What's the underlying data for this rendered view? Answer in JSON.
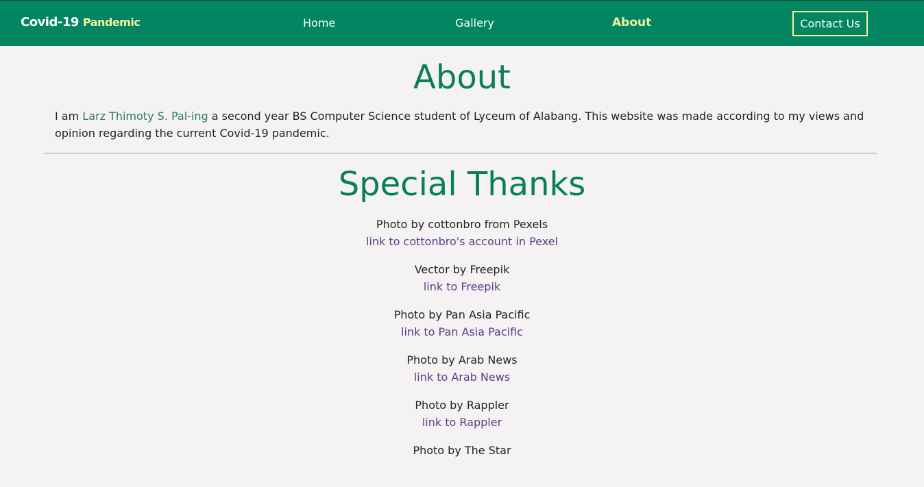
{
  "nav": {
    "brand": "Covid-19",
    "brand_accent": "Pandemic",
    "links": [
      "Home",
      "Gallery",
      "About"
    ],
    "contact": "Contact Us"
  },
  "about": {
    "title": "About",
    "intro_prefix": "I am ",
    "intro_name": "Larz Thimoty S. Pal-ing",
    "intro_suffix": " a second year BS Computer Science student of Lyceum of Alabang. This website was made according to my views and opinion regarding the current Covid-19 pandemic."
  },
  "thanks": {
    "title": "Special Thanks",
    "credits": [
      {
        "text": "Photo by cottonbro from Pexels",
        "link": "link to cottonbro's account in Pexel"
      },
      {
        "text": "Vector by Freepik",
        "link": "link to Freepik"
      },
      {
        "text": "Photo by Pan Asia Pacific",
        "link": "link to Pan Asia Pacific"
      },
      {
        "text": "Photo by Arab News",
        "link": "link to Arab News"
      },
      {
        "text": "Photo by Rappler",
        "link": "link to Rappler"
      },
      {
        "text": "Photo by The Star",
        "link": ""
      }
    ]
  },
  "colors": {
    "navbar": "#028661",
    "accent": "#f6f3a3",
    "heading": "#0a7d5c",
    "link": "#5b3c86"
  }
}
